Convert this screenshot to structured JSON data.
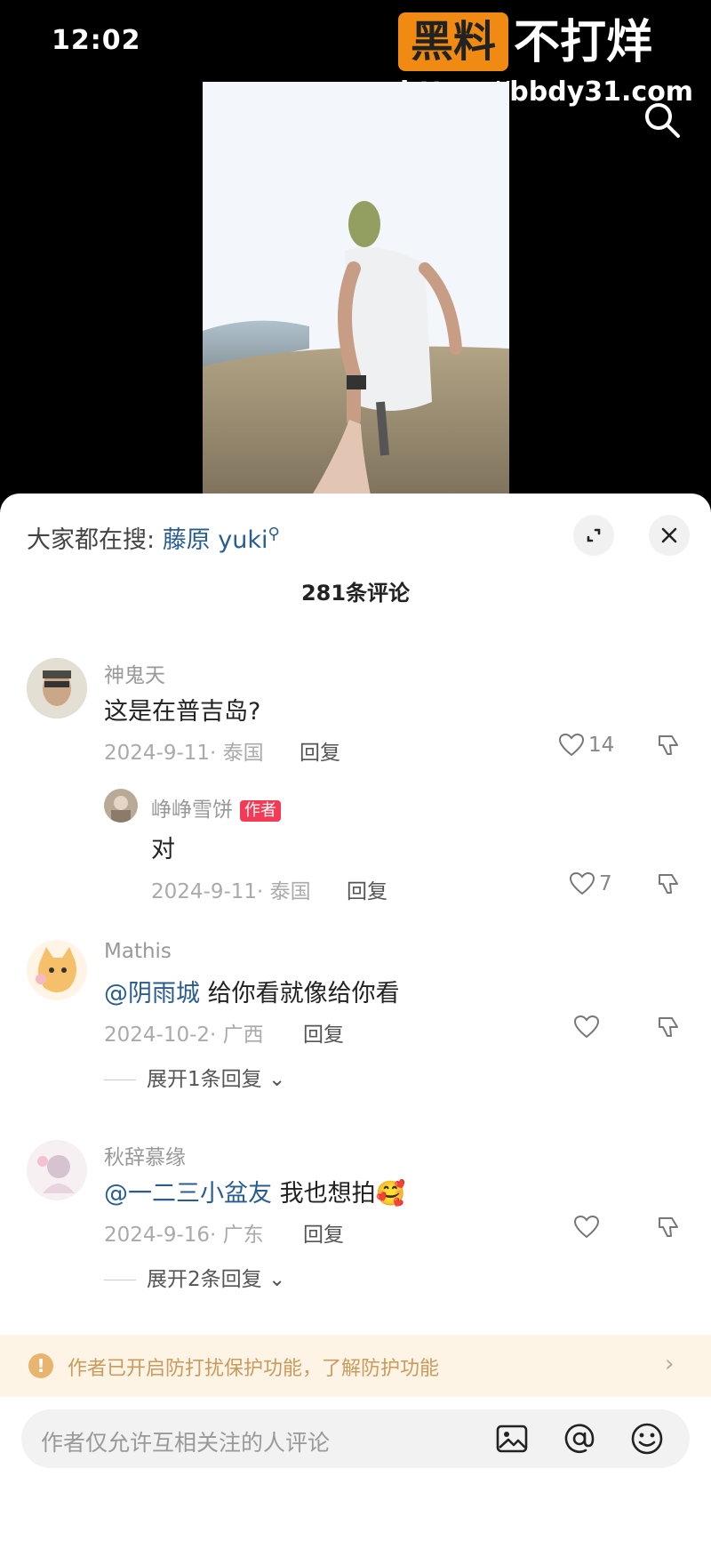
{
  "status_bar": {
    "time": "12:02"
  },
  "watermark": {
    "box_text": "黑料",
    "text": "不打烊",
    "url": "https://bbdy31.com"
  },
  "hot_search": {
    "prefix": "大家都在搜:",
    "keyword": "藤原 yuki"
  },
  "comment_count_title": "281条评论",
  "comments": [
    {
      "username": "神鬼天",
      "mention": "",
      "text": "这是在普吉岛?",
      "date": "2024-9-11· 泰国",
      "reply_label": "回复",
      "likes": "14"
    },
    {
      "username": "峥峥雪饼",
      "badge": "作者",
      "text": "对",
      "date": "2024-9-11· 泰国",
      "reply_label": "回复",
      "likes": "7"
    },
    {
      "username": "Mathis",
      "mention": "@阴雨城",
      "text": "给你看就像给你看",
      "date": "2024-10-2· 广西",
      "reply_label": "回复",
      "likes": "",
      "expand": "展开1条回复"
    },
    {
      "username": "秋辞慕缘",
      "mention": "@一二三小盆友",
      "text": "我也想拍",
      "emoji": "🥰",
      "date": "2024-9-16· 广东",
      "reply_label": "回复",
      "likes": "",
      "expand": "展开2条回复"
    }
  ],
  "notice": {
    "text": "作者已开启防打扰保护功能，了解防护功能"
  },
  "input": {
    "placeholder": "作者仅允许互相关注的人评论"
  },
  "colors": {
    "mention": "#2a5d8f",
    "author_badge": "#f43a55",
    "notice_bg": "#fdf4e6",
    "notice_text": "#c99a5c",
    "watermark_box": "#f08a12"
  }
}
